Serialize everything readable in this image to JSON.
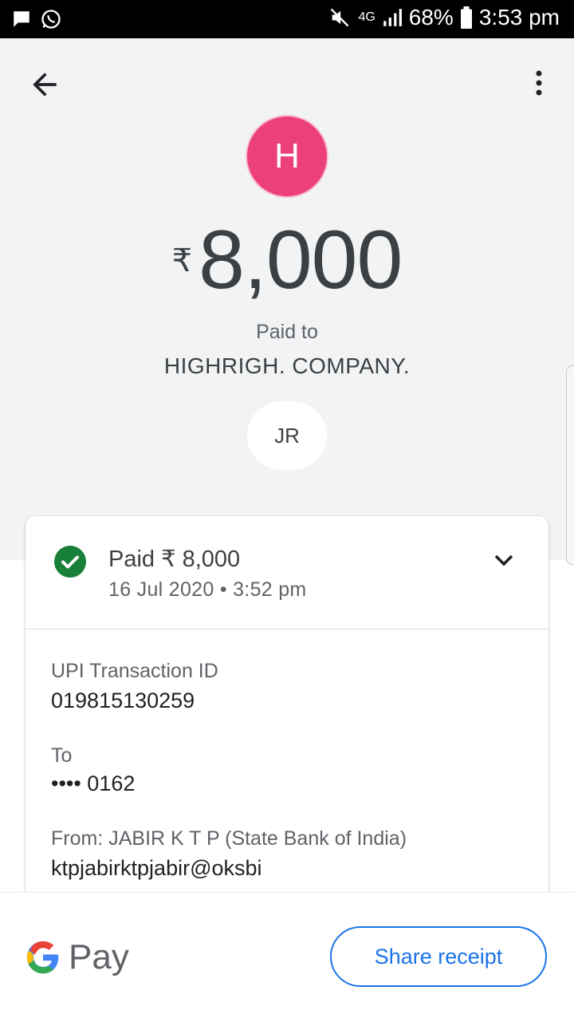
{
  "status_bar": {
    "network": "4G",
    "battery": "68%",
    "time": "3:53 pm"
  },
  "header": {
    "avatar_letter": "H"
  },
  "amount": {
    "currency": "₹",
    "value": "8,000"
  },
  "paid_to_label": "Paid to",
  "payee_name": "HIGHRIGH. COMPANY.",
  "sender_chip": "JR",
  "card": {
    "title": "Paid ₹ 8,000",
    "date": "16 Jul 2020 • 3:52 pm",
    "status_color": "#188038",
    "details": [
      {
        "label": "UPI Transaction ID",
        "value": "019815130259"
      },
      {
        "label": "To",
        "value": "•••• 0162"
      },
      {
        "label": "From: JABIR  K T P (State Bank of India)",
        "value": "ktpjabirktpjabir@oksbi"
      }
    ]
  },
  "footer": {
    "brand": "Pay",
    "share_label": "Share receipt",
    "accent": "#1a73e8"
  },
  "icons": [
    "message-icon",
    "whatsapp-icon",
    "mute-icon",
    "signal-icon",
    "battery-icon",
    "back-arrow-icon",
    "more-vert-icon",
    "check-circle-icon",
    "chevron-down-icon",
    "google-g-icon"
  ]
}
